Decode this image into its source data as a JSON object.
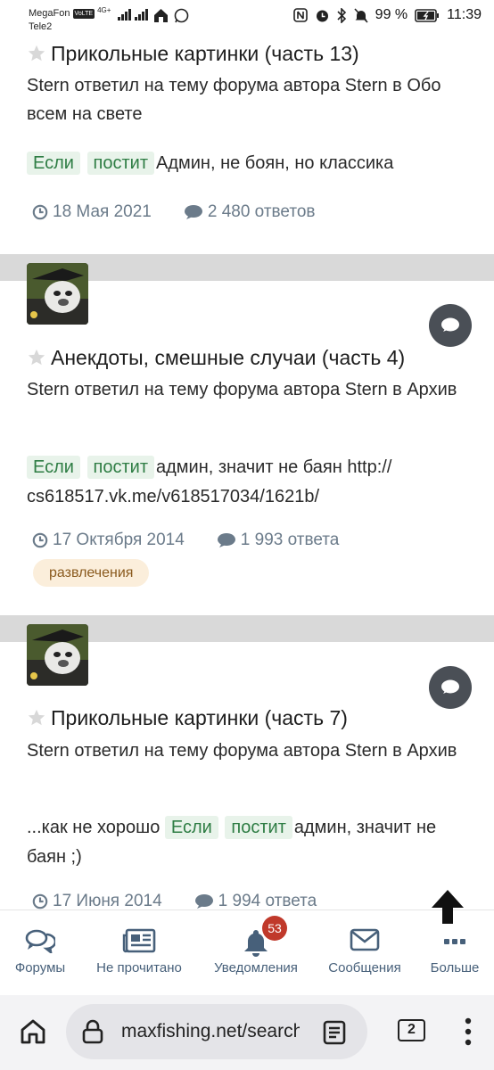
{
  "status_bar": {
    "carrier1": "MegaFon",
    "volte": "VoLTE",
    "network": "4G+",
    "carrier2": "Tele2",
    "battery": "99 %",
    "time": "11:39"
  },
  "posts": [
    {
      "title": "Прикольные картинки (часть 13)",
      "desc": "Stern ответил на тему форума автора Stern в Обо всем на свете",
      "hl1": "Если",
      "hl2": "постит",
      "snippet_prefix": "",
      "snippet_suffix": "Админ, не боян, но классика",
      "date": "18 Мая 2021",
      "replies": "2 480 ответов"
    },
    {
      "title": "Анекдоты, смешные случаи (часть 4)",
      "desc": "Stern ответил на тему форума автора Stern в Архив",
      "hl1": "Если",
      "hl2": "постит",
      "snippet_prefix": "",
      "snippet_suffix": "админ, значит не баян http:// cs618517.vk.me/v618517034/1621b/",
      "date": "17 Октября 2014",
      "replies": "1 993 ответа",
      "tag": "развлечения"
    },
    {
      "title": "Прикольные картинки (часть 7)",
      "desc": "Stern ответил на тему форума автора Stern в Архив",
      "hl1": "Если",
      "hl2": "постит",
      "snippet_prefix": "...как не хорошо ",
      "snippet_suffix": "админ, значит не баян ;)",
      "date": "17 Июня 2014",
      "replies": "1 994 ответа"
    }
  ],
  "bottom_nav": {
    "forums": "Форумы",
    "unread": "Не прочитано",
    "notifications": "Уведомления",
    "notifications_badge": "53",
    "messages": "Сообщения",
    "more": "Больше"
  },
  "browser": {
    "url": "maxfishing.net/search",
    "tabs_count": "2"
  },
  "colors": {
    "accent": "#47607a",
    "highlight_bg": "#e8f3ea",
    "highlight_text": "#2e7d44",
    "badge": "#c0392b",
    "tag_bg": "#fbeedb"
  }
}
